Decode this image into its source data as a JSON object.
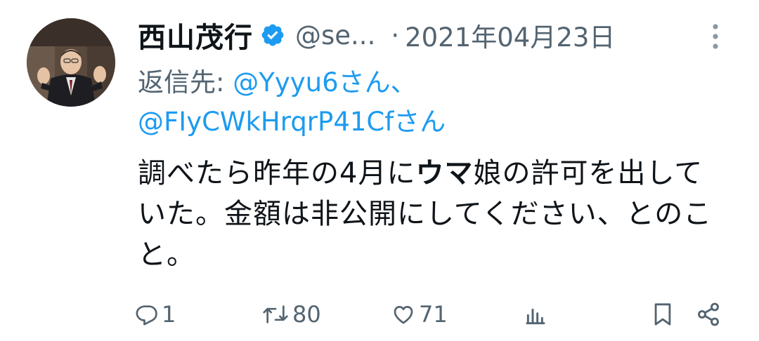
{
  "author": {
    "display_name": "西山茂行",
    "handle": "@se...",
    "separator": "·",
    "date": "2021年04月23日",
    "verified": true
  },
  "reply": {
    "prefix": "返信先: ",
    "mention_1": "@Yyyu6さん、",
    "mention_2": "@FIyCWkHrqrP41Cfさん"
  },
  "tweet": {
    "part_1": "調べたら昨年の4月に",
    "bold": "ウマ",
    "part_2": "娘の許可を出していた。金額は非公開にしてください、とのこと。"
  },
  "actions": {
    "reply_count": "1",
    "retweet_count": "80",
    "like_count": "71"
  },
  "colors": {
    "text": "#0f1419",
    "secondary": "#536471",
    "accent": "#1d9bf0"
  },
  "icons": {
    "avatar": "profile-photo",
    "verified": "verified-badge-icon",
    "more": "more-vertical-icon",
    "reply": "reply-icon",
    "retweet": "retweet-icon",
    "like": "heart-icon",
    "views": "analytics-icon",
    "bookmark": "bookmark-icon",
    "share": "share-icon"
  }
}
